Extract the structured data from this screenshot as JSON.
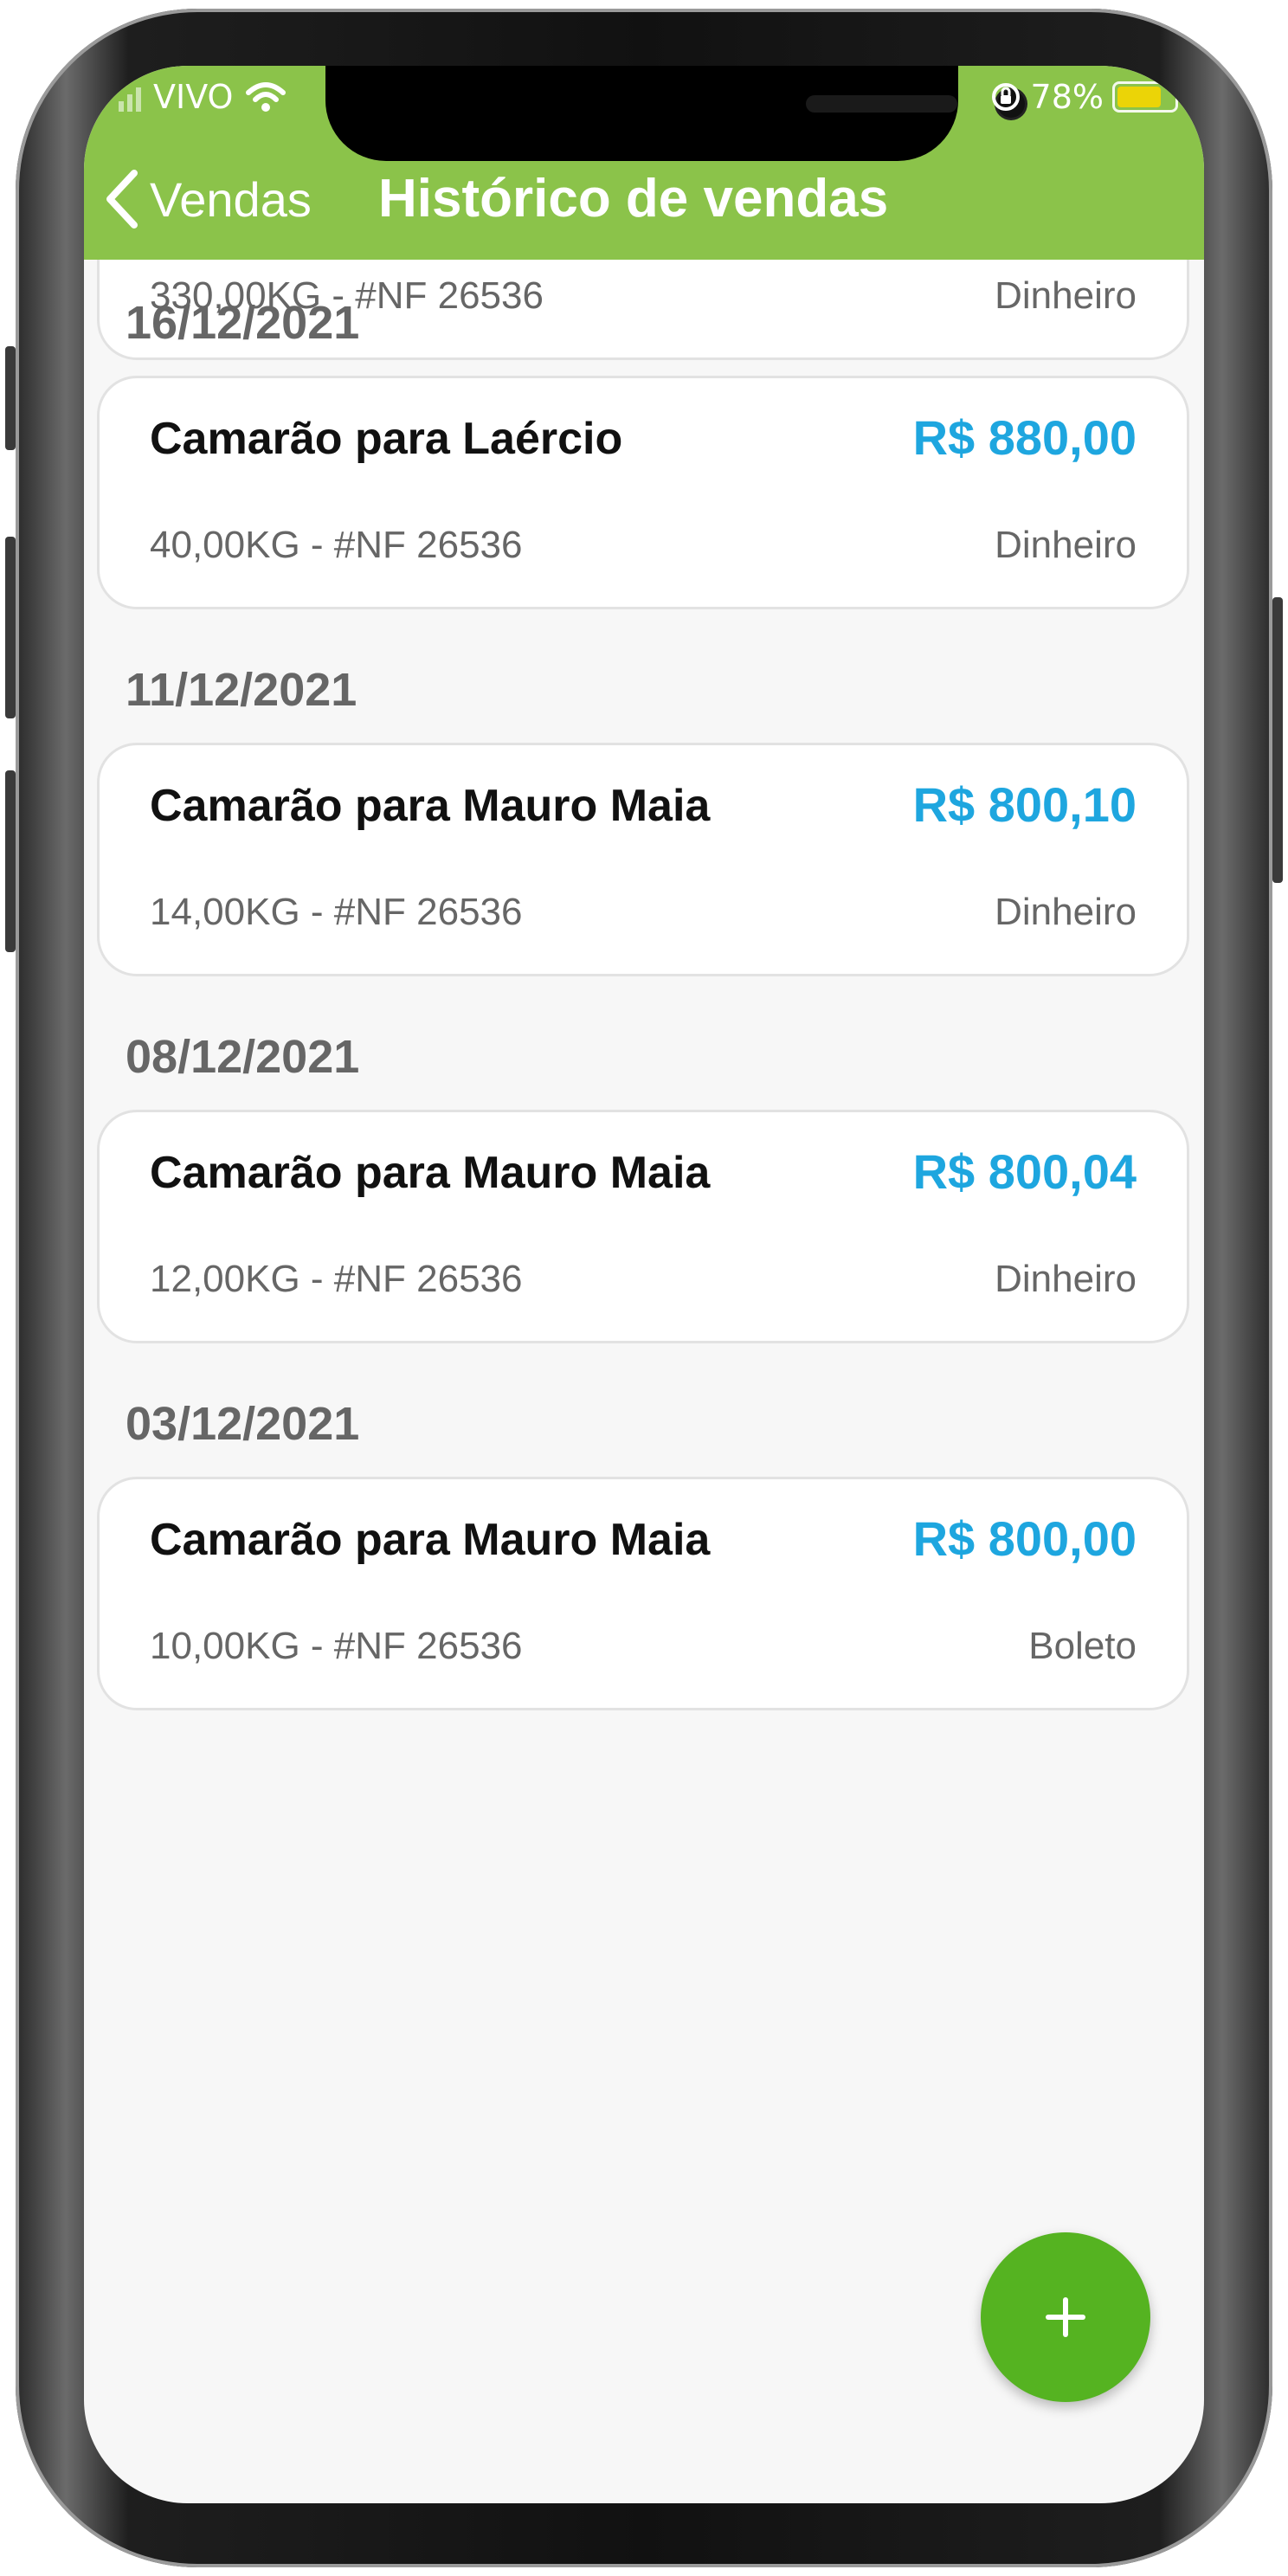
{
  "status_bar": {
    "carrier": "VIVO",
    "battery": "78%",
    "battery_level": 0.78
  },
  "header": {
    "back_label": "Vendas",
    "title": "Histórico de vendas"
  },
  "partial_card": {
    "meta": "330,00KG - #NF 26536",
    "payment": "Dinheiro"
  },
  "groups": [
    {
      "date": "16/12/2021",
      "sale": {
        "title": "Camarão para Laércio",
        "price": "R$ 880,00",
        "meta": "40,00KG - #NF 26536",
        "payment": "Dinheiro"
      }
    },
    {
      "date": "11/12/2021",
      "sale": {
        "title": "Camarão para Mauro Maia",
        "price": "R$ 800,10",
        "meta": "14,00KG - #NF 26536",
        "payment": "Dinheiro"
      }
    },
    {
      "date": "08/12/2021",
      "sale": {
        "title": "Camarão para Mauro Maia",
        "price": "R$ 800,04",
        "meta": "12,00KG - #NF 26536",
        "payment": "Dinheiro"
      }
    },
    {
      "date": "03/12/2021",
      "sale": {
        "title": "Camarão para Mauro Maia",
        "price": "R$ 800,00",
        "meta": "10,00KG - #NF 26536",
        "payment": "Boleto"
      }
    }
  ],
  "fab": {
    "icon": "plus-icon"
  },
  "colors": {
    "header": "#8bc34a",
    "price": "#1ea6df",
    "fab": "#55b321"
  }
}
